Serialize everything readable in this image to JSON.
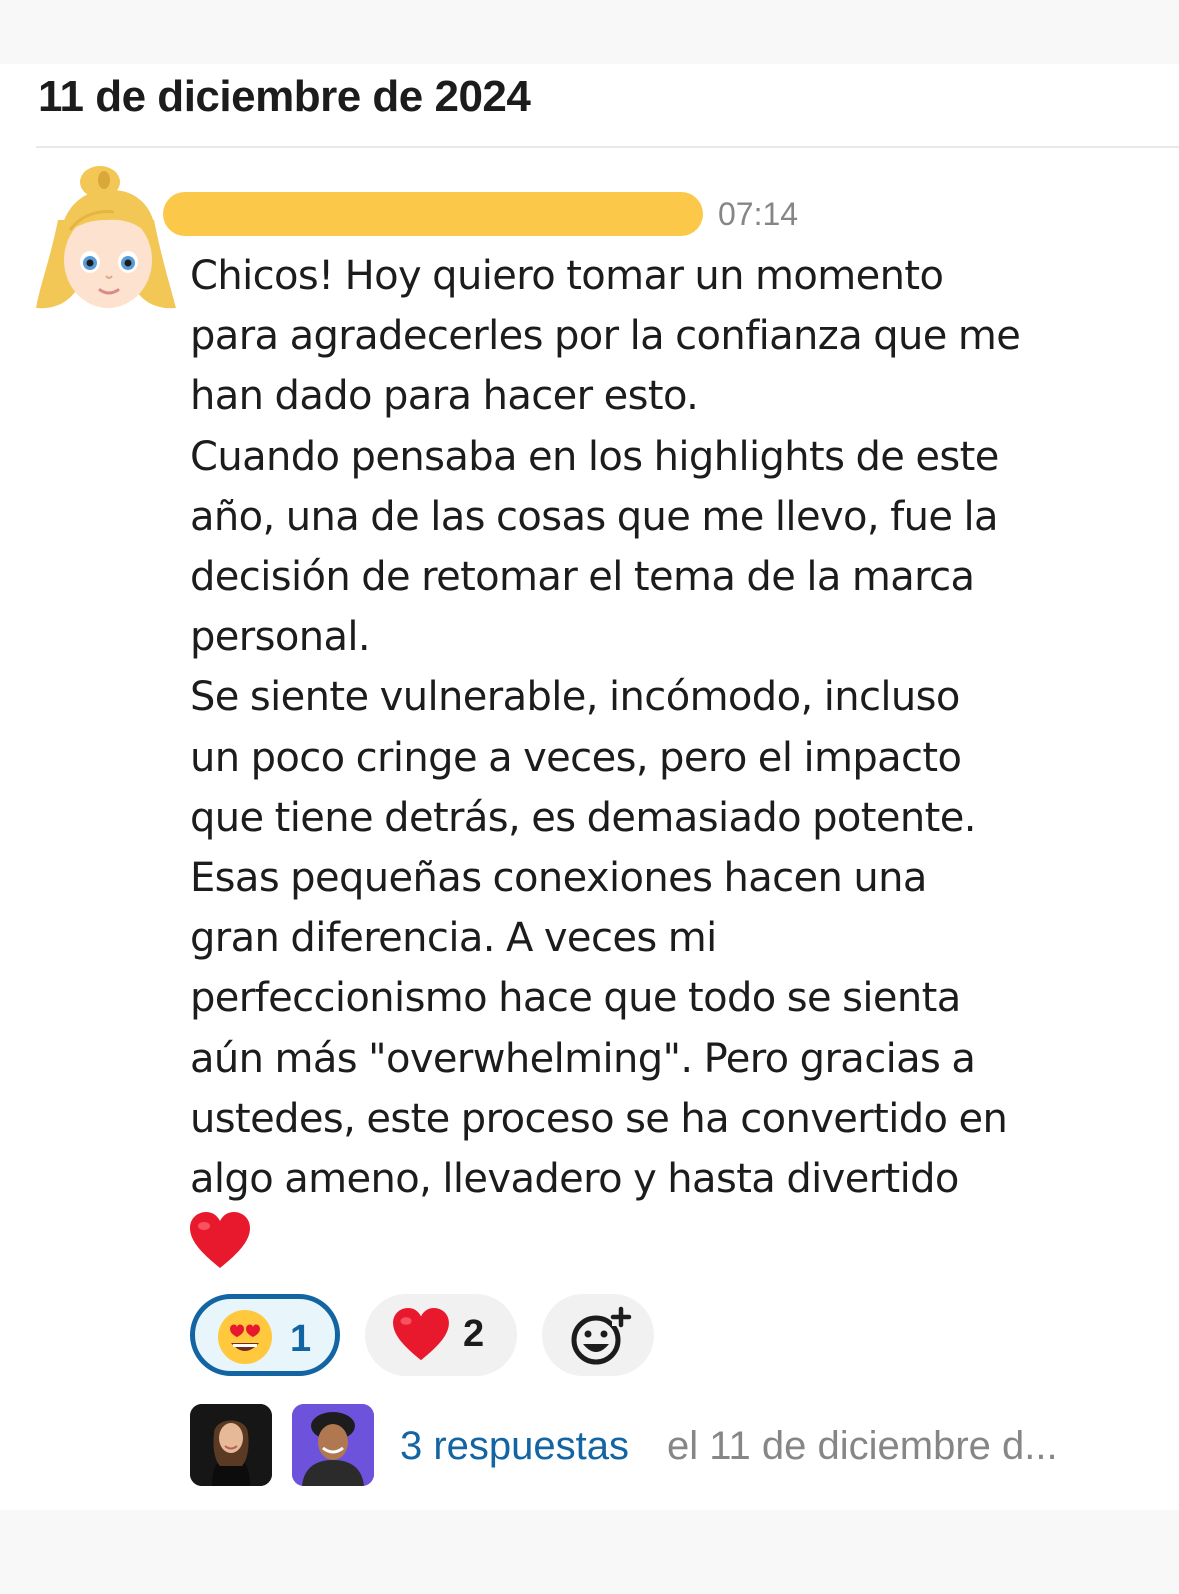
{
  "day_header": "11 de diciembre de 2024",
  "message": {
    "timestamp": "07:14",
    "lines": [
      "Chicos! Hoy quiero tomar un momento",
      "para agradecerles por la confianza que me",
      "han dado para hacer esto.",
      "Cuando pensaba en los highlights de este",
      "año, una de las cosas que me llevo, fue la",
      "decisión de retomar el tema de la marca",
      "personal.",
      "Se siente vulnerable, incómodo, incluso",
      "un poco cringe a veces, pero el impacto",
      "que tiene detrás, es demasiado potente.",
      "Esas pequeñas conexiones hacen una",
      "gran diferencia. A veces mi",
      "perfeccionismo hace que todo se sienta",
      "aún más \"overwhelming\". Pero gracias a",
      "ustedes, este proceso se ha convertido en",
      "algo ameno, llevadero y hasta divertido"
    ],
    "trailing_emoji": "heart-emoji"
  },
  "reactions": [
    {
      "emoji": "heart-eyes-emoji",
      "count": "1",
      "selected": true
    },
    {
      "emoji": "red-heart-emoji",
      "count": "2",
      "selected": false
    },
    {
      "emoji": "add-reaction-icon"
    }
  ],
  "thread": {
    "replies_label": "3 respuestas",
    "last_reply": "el 11 de diciembre d..."
  },
  "colors": {
    "link_blue": "#1264a3",
    "redaction_yellow": "#fcc84a",
    "muted_gray": "#868686"
  }
}
